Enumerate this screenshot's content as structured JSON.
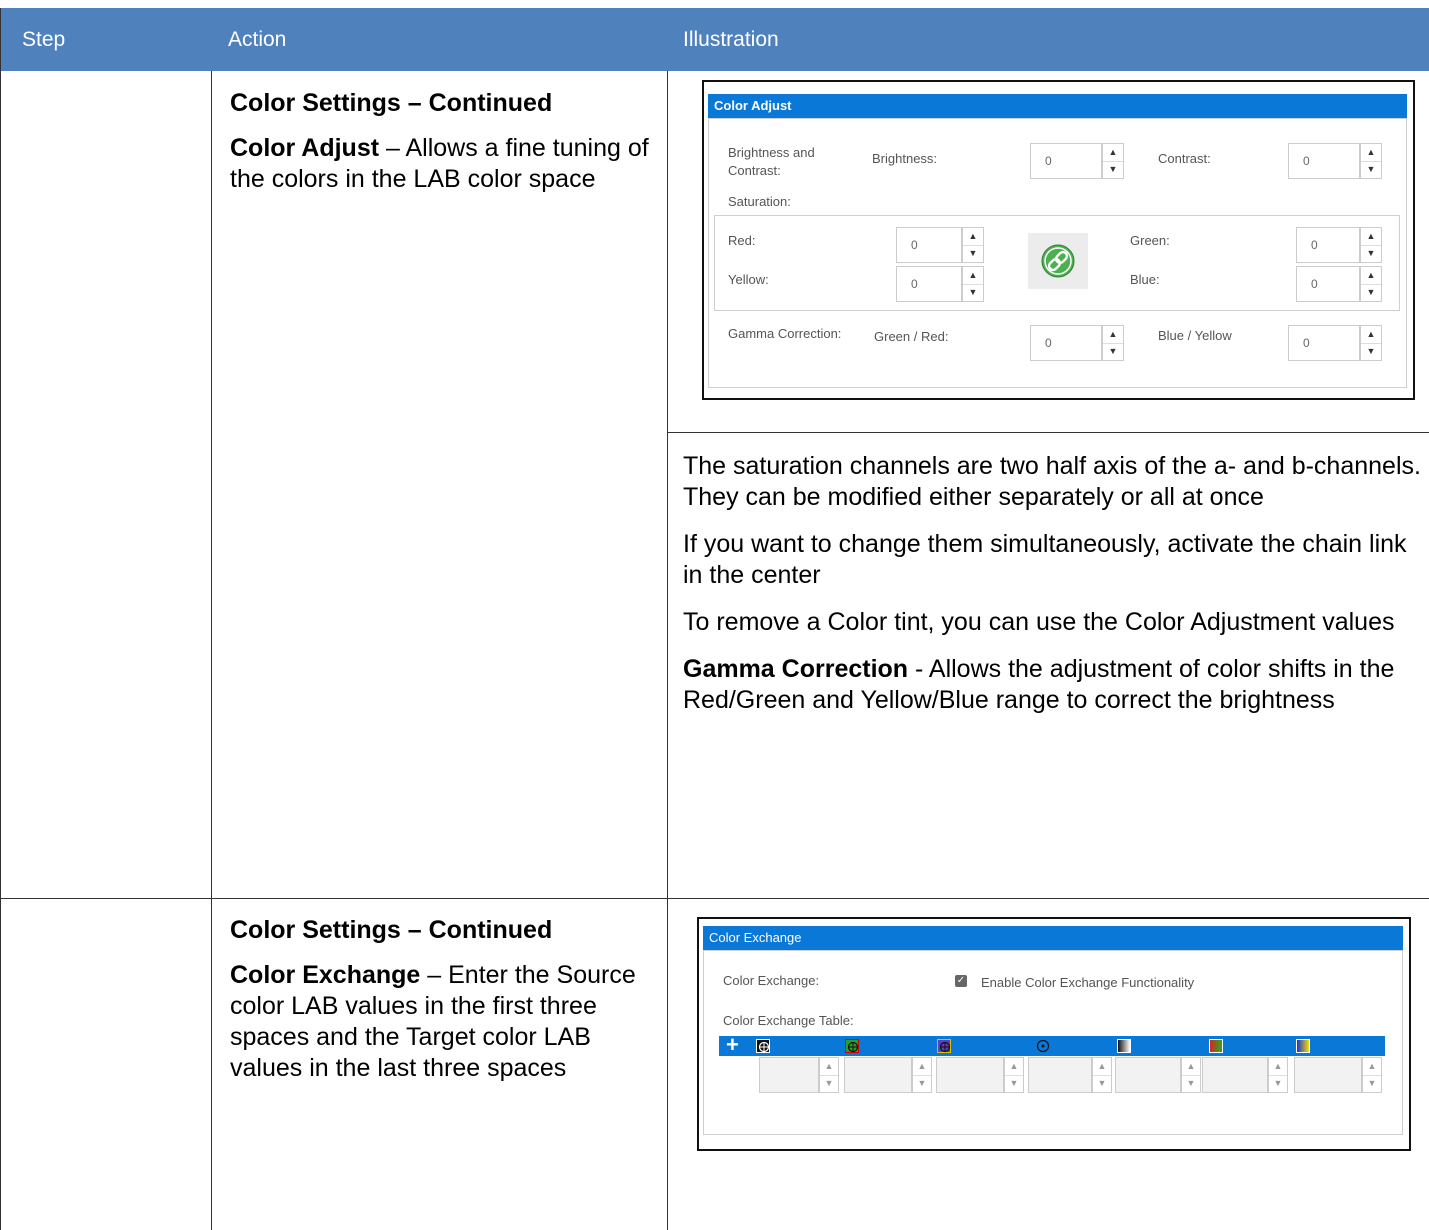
{
  "header": {
    "step": "Step",
    "action": "Action",
    "illustration": "Illustration"
  },
  "rows": [
    {
      "action_title": "Color Settings – Continued",
      "action_bold": "Color Adjust",
      "action_text": " – Allows a fine tuning of the colors in the LAB color space",
      "panel": {
        "title": "Color Adjust",
        "brightness_contrast_label": "Brightness and Contrast:",
        "brightness_label": "Brightness:",
        "brightness_value": "0",
        "contrast_label": "Contrast:",
        "contrast_value": "0",
        "saturation_label": "Saturation:",
        "red_label": "Red:",
        "red_value": "0",
        "yellow_label": "Yellow:",
        "yellow_value": "0",
        "green_label": "Green:",
        "green_value": "0",
        "blue_label": "Blue:",
        "blue_value": "0",
        "gamma_label": "Gamma Correction:",
        "green_red_label": "Green / Red:",
        "green_red_value": "0",
        "blue_yellow_label": "Blue / Yellow",
        "blue_yellow_value": "0"
      },
      "description": {
        "p1": "The saturation channels are two half axis of the a- and b-channels. They can be modified either separately or all at once",
        "p2": "If you want to change them simultaneously, activate the chain link in the center",
        "p3": "To remove a Color tint, you can use the Color Adjustment values",
        "p4_bold": "Gamma Correction",
        "p4_text": " - Allows the adjustment of color shifts in the Red/Green and Yellow/Blue range to correct the brightness"
      }
    },
    {
      "action_title": "Color Settings – Continued",
      "action_bold": "Color Exchange",
      "action_text": " – Enter the Source color LAB values in the first three spaces and the Target color LAB values in the last three spaces",
      "panel": {
        "title": "Color Exchange",
        "exchange_label": "Color Exchange:",
        "enable_label": "Enable Color Exchange Functionality",
        "table_label": "Color Exchange Table:",
        "add_symbol": "+",
        "column_icons": [
          "source-l-icon",
          "source-a-icon",
          "source-b-icon",
          "target-l-icon",
          "target-gradient-gray-icon",
          "target-gradient-red-green-icon",
          "target-gradient-blue-yellow-icon"
        ]
      }
    }
  ],
  "colors": {
    "header": "#4f81bd",
    "panel_title": "#0a78d7",
    "chain_link": "#4caf50"
  }
}
